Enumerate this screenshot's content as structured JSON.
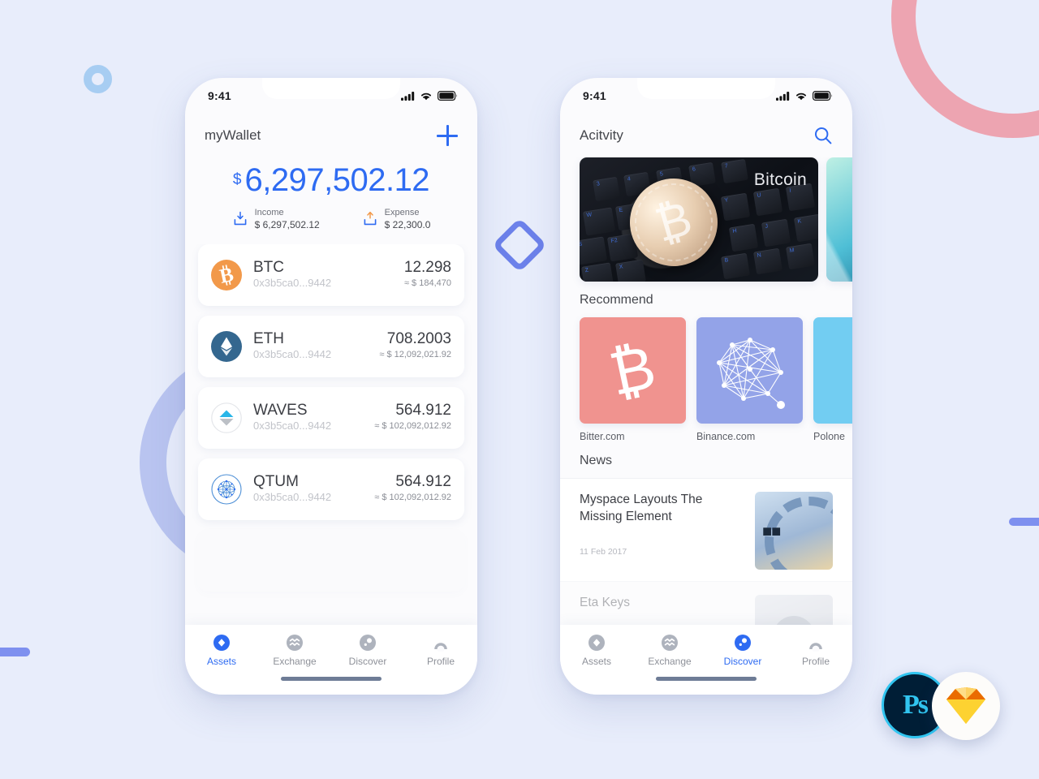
{
  "background": {
    "color": "#e8edfb",
    "shapes": [
      {
        "name": "ring-small-blue",
        "color": "#a7cdf2"
      },
      {
        "name": "arc-pink",
        "color": "#eda4b1"
      },
      {
        "name": "arc-periwinkle",
        "color": "#b9c4f0"
      },
      {
        "name": "bar-left",
        "color": "#7e90ef"
      },
      {
        "name": "bar-right",
        "color": "#7e90ef"
      },
      {
        "name": "diamond-outline",
        "color": "#6c81ea"
      }
    ]
  },
  "accent": {
    "primary_blue": "#2e6bf2",
    "btc_orange": "#f2994a",
    "eth_blue": "#34678f",
    "waves_cyan": "#29b6e8",
    "expense_orange": "#f2994a"
  },
  "badges": {
    "photoshop": "Ps",
    "sketch": "sketch-diamond-icon"
  },
  "phone_assets": {
    "status_bar": {
      "time": "9:41",
      "icons": [
        "signal-icon",
        "wifi-icon",
        "battery-icon"
      ]
    },
    "nav": {
      "title": "myWallet",
      "add_button": "+"
    },
    "balance": {
      "currency_symbol": "$",
      "amount": "6,297,502.12",
      "income": {
        "label": "Income",
        "value": "$ 6,297,502.12",
        "icon": "download-tray-icon"
      },
      "expense": {
        "label": "Expense",
        "value": "$ 22,300.0",
        "icon": "upload-tray-icon"
      }
    },
    "assets": [
      {
        "symbol": "BTC",
        "icon": "btc-coin-icon",
        "address": "0x3b5ca0...9442",
        "amount": "12.298",
        "fiat": "≈ $ 184,470"
      },
      {
        "symbol": "ETH",
        "icon": "eth-coin-icon",
        "address": "0x3b5ca0...9442",
        "amount": "708.2003",
        "fiat": "≈ $ 12,092,021.92"
      },
      {
        "symbol": "WAVES",
        "icon": "waves-coin-icon",
        "address": "0x3b5ca0...9442",
        "amount": "564.912",
        "fiat": "≈ $ 102,092,012.92"
      },
      {
        "symbol": "QTUM",
        "icon": "qtum-coin-icon",
        "address": "0x3b5ca0...9442",
        "amount": "564.912",
        "fiat": "≈ $ 102,092,012.92"
      }
    ],
    "tabs": [
      {
        "label": "Assets",
        "icon": "assets-diamond-icon",
        "active": true
      },
      {
        "label": "Exchange",
        "icon": "exchange-wave-icon",
        "active": false
      },
      {
        "label": "Discover",
        "icon": "discover-compass-icon",
        "active": false
      },
      {
        "label": "Profile",
        "icon": "profile-person-icon",
        "active": false
      }
    ]
  },
  "phone_discover": {
    "status_bar": {
      "time": "9:41",
      "icons": [
        "signal-icon",
        "wifi-icon",
        "battery-icon"
      ]
    },
    "nav": {
      "title": "Acitvity",
      "search_icon": "search-icon"
    },
    "carousel": [
      {
        "caption": "Bitcoin",
        "image": "bitcoin-coin-on-keyboard"
      },
      {
        "caption": "",
        "image": "teal-abstract"
      }
    ],
    "recommend": {
      "title": "Recommend",
      "items": [
        {
          "name": "Bitter.com",
          "icon": "btc-glyph-icon",
          "color": "#f0938f"
        },
        {
          "name": "Binance.com",
          "icon": "network-mesh-icon",
          "color": "#93a3e8"
        },
        {
          "name": "Polone",
          "icon": "dot-icon",
          "color": "#72cdf2"
        }
      ]
    },
    "news": {
      "title": "News",
      "items": [
        {
          "title": "Myspace Layouts The Missing Element",
          "date": "11 Feb 2017",
          "thumb": "ibm-server-photo"
        },
        {
          "title": "Eta Keys",
          "date": "",
          "thumb": "avatar-photo"
        }
      ]
    },
    "tabs": [
      {
        "label": "Assets",
        "icon": "assets-diamond-icon",
        "active": false
      },
      {
        "label": "Exchange",
        "icon": "exchange-wave-icon",
        "active": false
      },
      {
        "label": "Discover",
        "icon": "discover-compass-icon",
        "active": true
      },
      {
        "label": "Profile",
        "icon": "profile-person-icon",
        "active": false
      }
    ]
  }
}
